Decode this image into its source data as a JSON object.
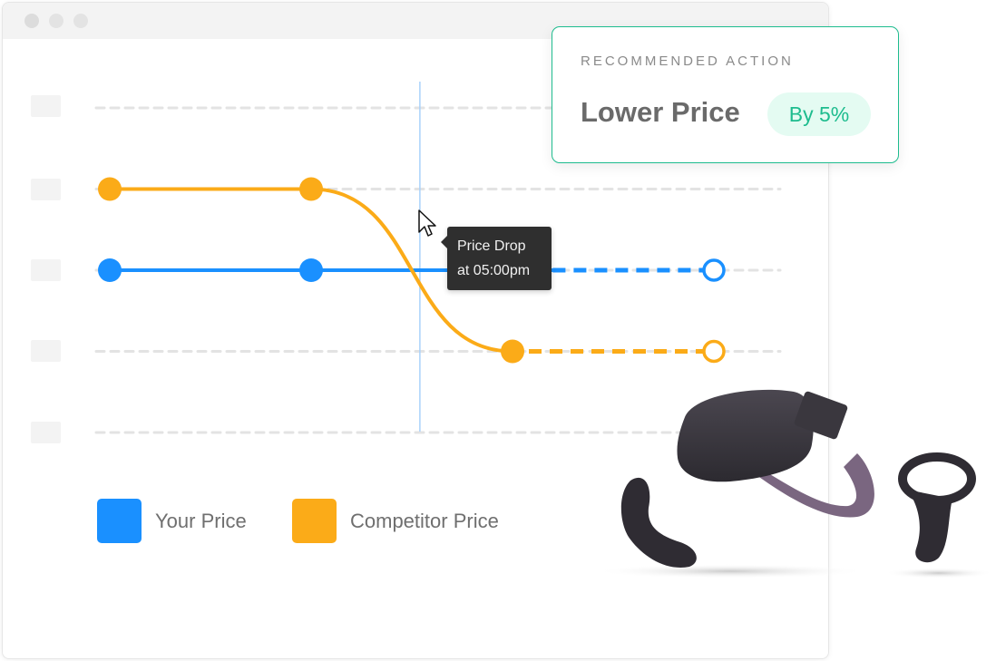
{
  "window": {
    "controls": [
      "close",
      "minimize",
      "maximize"
    ]
  },
  "card": {
    "eyebrow": "RECOMMENDED ACTION",
    "action": "Lower Price",
    "badge": "By 5%",
    "accent_color": "#1ebc8e",
    "badge_bg": "#e4fbf2"
  },
  "tooltip": {
    "line1": "Price Drop",
    "line2": "at 05:00pm"
  },
  "legend": [
    {
      "label": "Your Price",
      "color": "#1a90ff"
    },
    {
      "label": "Competitor Price",
      "color": "#fbab18"
    }
  ],
  "product_image": {
    "icon": "vr-headset-with-controllers-icon"
  },
  "chart_data": {
    "type": "line",
    "title": "",
    "xlabel": "",
    "ylabel": "",
    "x": [
      0,
      1,
      2,
      3
    ],
    "ytick_labels": [
      "",
      "",
      "",
      "",
      ""
    ],
    "ylim": [
      0,
      4
    ],
    "grid": true,
    "marker_x": 1.54,
    "marker_label": "Price Drop at 05:00pm",
    "legend_position": "bottom-left",
    "series": [
      {
        "name": "Your Price",
        "color": "#1a90ff",
        "values": [
          2,
          2,
          2,
          2
        ],
        "solid_until": 2.2,
        "projected_from": 2.2,
        "hollow_last": true
      },
      {
        "name": "Competitor Price",
        "color": "#fbab18",
        "values": [
          3,
          3,
          1,
          1
        ],
        "solid_until": 2,
        "projected_from": 2,
        "hollow_last": true,
        "smooth": true
      }
    ]
  }
}
